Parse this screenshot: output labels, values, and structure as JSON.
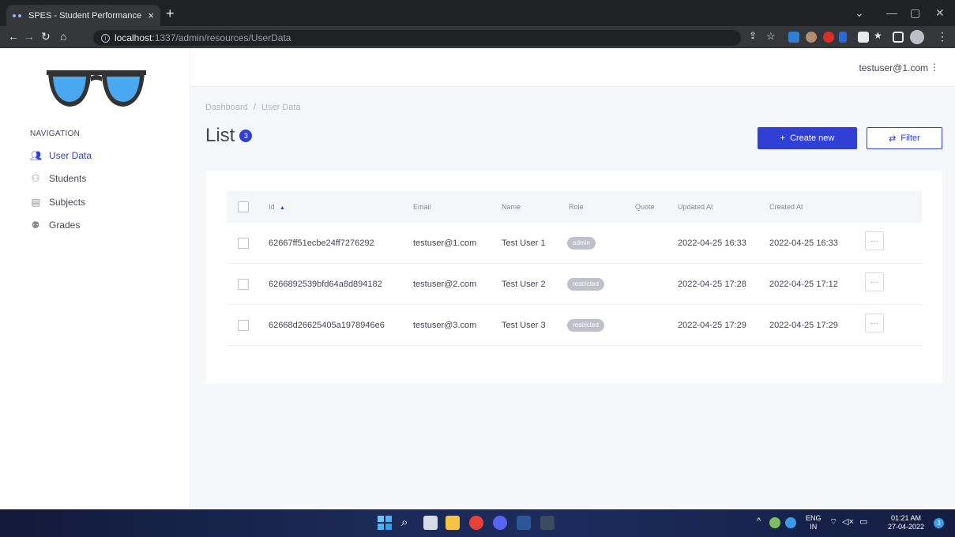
{
  "browser": {
    "tab_title": "SPES - Student Performance Eval",
    "tab_close": "×",
    "new_tab": "+",
    "url_host": "localhost",
    "url_path": ":1337/admin/resources/UserData"
  },
  "sidebar": {
    "heading": "NAVIGATION",
    "items": [
      {
        "label": "User Data",
        "icon": "users-icon",
        "active": true
      },
      {
        "label": "Students",
        "icon": "students-icon",
        "active": false
      },
      {
        "label": "Subjects",
        "icon": "subjects-icon",
        "active": false
      },
      {
        "label": "Grades",
        "icon": "grades-icon",
        "active": false
      }
    ]
  },
  "topbar": {
    "user_email": "testuser@1.com",
    "menu_glyph": "⋮"
  },
  "breadcrumb": {
    "root": "Dashboard",
    "separator": "/",
    "current": "User Data"
  },
  "page": {
    "title": "List",
    "count": "3"
  },
  "actions": {
    "create_label": "Create new",
    "create_glyph": "+",
    "filter_label": "Filter",
    "filter_glyph": "⇄"
  },
  "table": {
    "columns": [
      "Id",
      "Email",
      "Name",
      "Role",
      "Quote",
      "Updated At",
      "Created At"
    ],
    "sort_glyph": "▲",
    "rows": [
      {
        "id": "62667ff51ecbe24ff7276292",
        "email": "testuser@1.com",
        "name": "Test User 1",
        "role": "admin",
        "quote": "",
        "updated_at": "2022-04-25 16:33",
        "created_at": "2022-04-25 16:33"
      },
      {
        "id": "6266892539bfd64a8d894182",
        "email": "testuser@2.com",
        "name": "Test User 2",
        "role": "restricted",
        "quote": "",
        "updated_at": "2022-04-25 17:28",
        "created_at": "2022-04-25 17:12"
      },
      {
        "id": "62668d26625405a1978946e6",
        "email": "testuser@3.com",
        "name": "Test User 3",
        "role": "restricted",
        "quote": "",
        "updated_at": "2022-04-25 17:29",
        "created_at": "2022-04-25 17:29"
      }
    ],
    "row_action_glyph": "···"
  },
  "taskbar": {
    "lang_top": "ENG",
    "lang_bottom": "IN",
    "time": "01:21 AM",
    "date": "27-04-2022",
    "notification_count": "3"
  },
  "colors": {
    "primary": "#3040d6",
    "badge_grey": "#c0c0ca",
    "logo_lens": "#4aa8f0",
    "logo_frame": "#333333"
  }
}
